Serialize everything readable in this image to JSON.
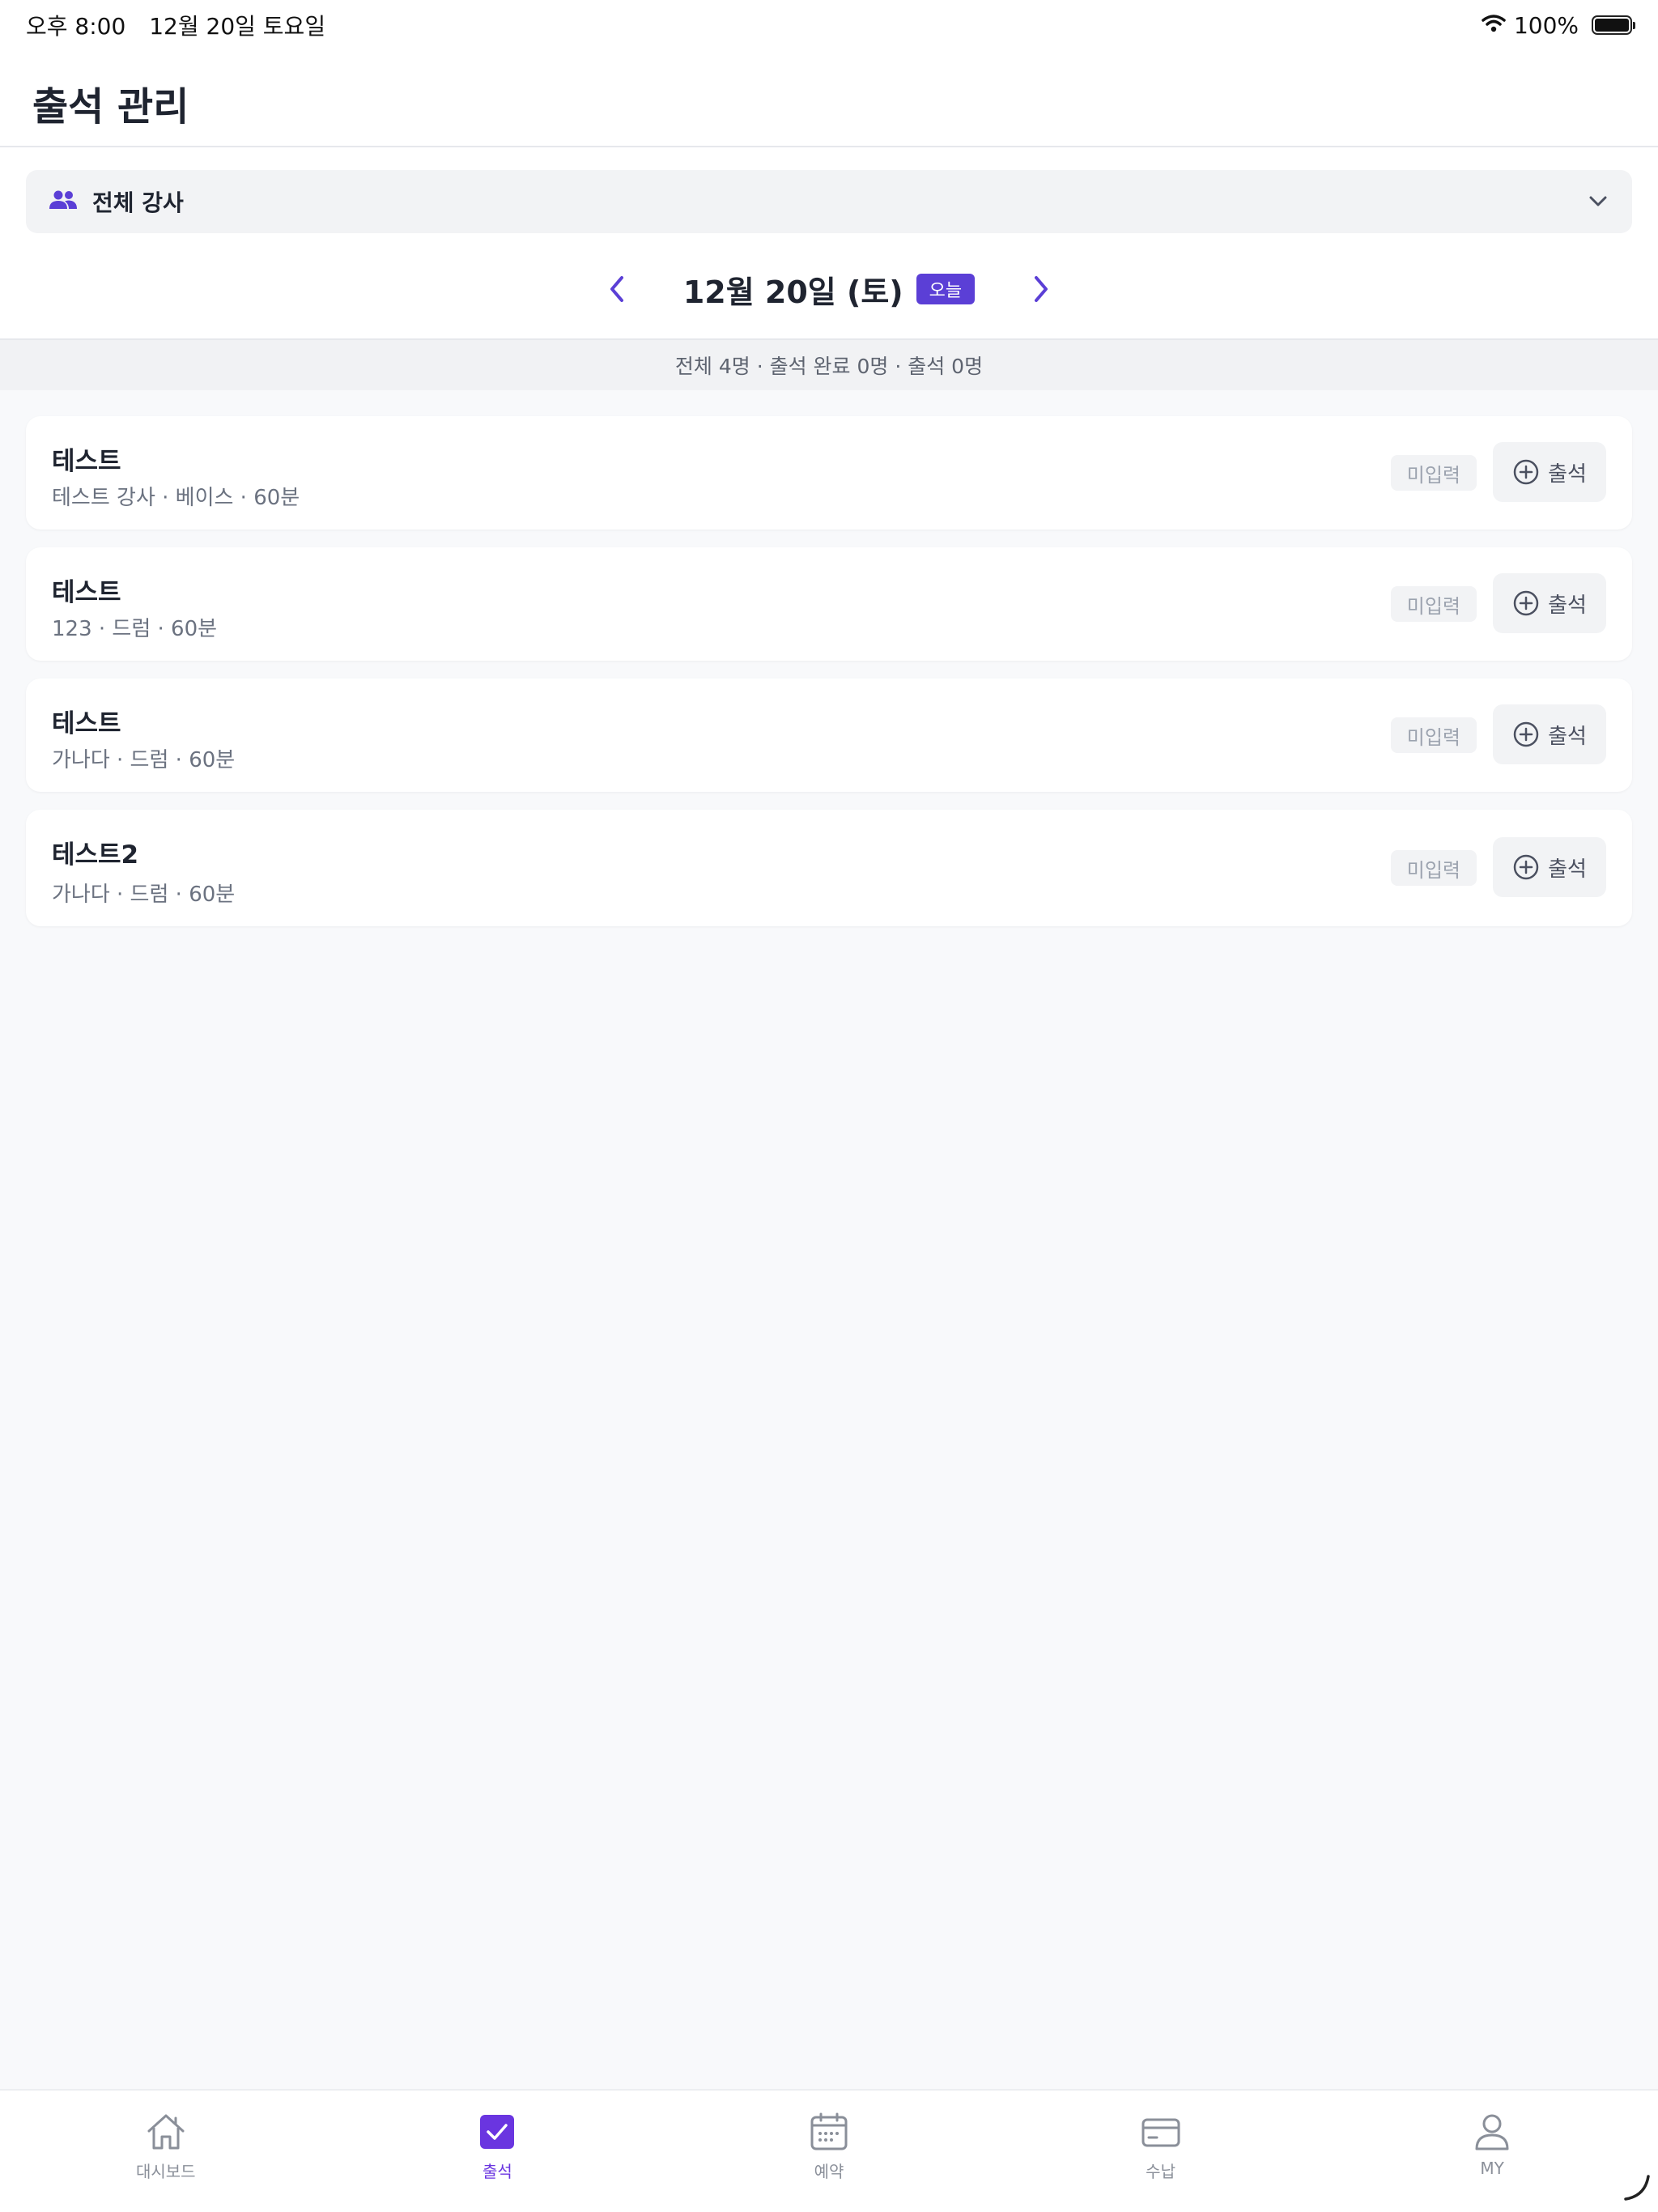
{
  "status_bar": {
    "time": "오후 8:00",
    "date": "12월 20일 토요일",
    "battery": "100%"
  },
  "header": {
    "title": "출석 관리"
  },
  "filter": {
    "instructor_label": "전체 강사"
  },
  "date_nav": {
    "date": "12월 20일 (토)",
    "today_badge": "오늘"
  },
  "summary": {
    "text": "전체 4명 · 출석 완료 0명 · 출석 0명"
  },
  "attendance_list": [
    {
      "name": "테스트",
      "meta": "테스트 강사 · 베이스 · 60분",
      "status": "미입력",
      "action": "출석"
    },
    {
      "name": "테스트",
      "meta": "123 · 드럼 · 60분",
      "status": "미입력",
      "action": "출석"
    },
    {
      "name": "테스트",
      "meta": "가나다 · 드럼 · 60분",
      "status": "미입력",
      "action": "출석"
    },
    {
      "name": "테스트2",
      "meta": "가나다 · 드럼 · 60분",
      "status": "미입력",
      "action": "출석"
    }
  ],
  "tab_bar": {
    "active": "출석",
    "tabs": [
      {
        "label": "대시보드",
        "icon": "home-icon"
      },
      {
        "label": "출석",
        "icon": "checkbox-icon"
      },
      {
        "label": "예약",
        "icon": "calendar-icon"
      },
      {
        "label": "수납",
        "icon": "card-icon"
      },
      {
        "label": "MY",
        "icon": "person-icon"
      }
    ]
  },
  "colors": {
    "accent": "#5b3fd6",
    "tab_active": "#6a35e0",
    "background": "#f8f9fb"
  }
}
